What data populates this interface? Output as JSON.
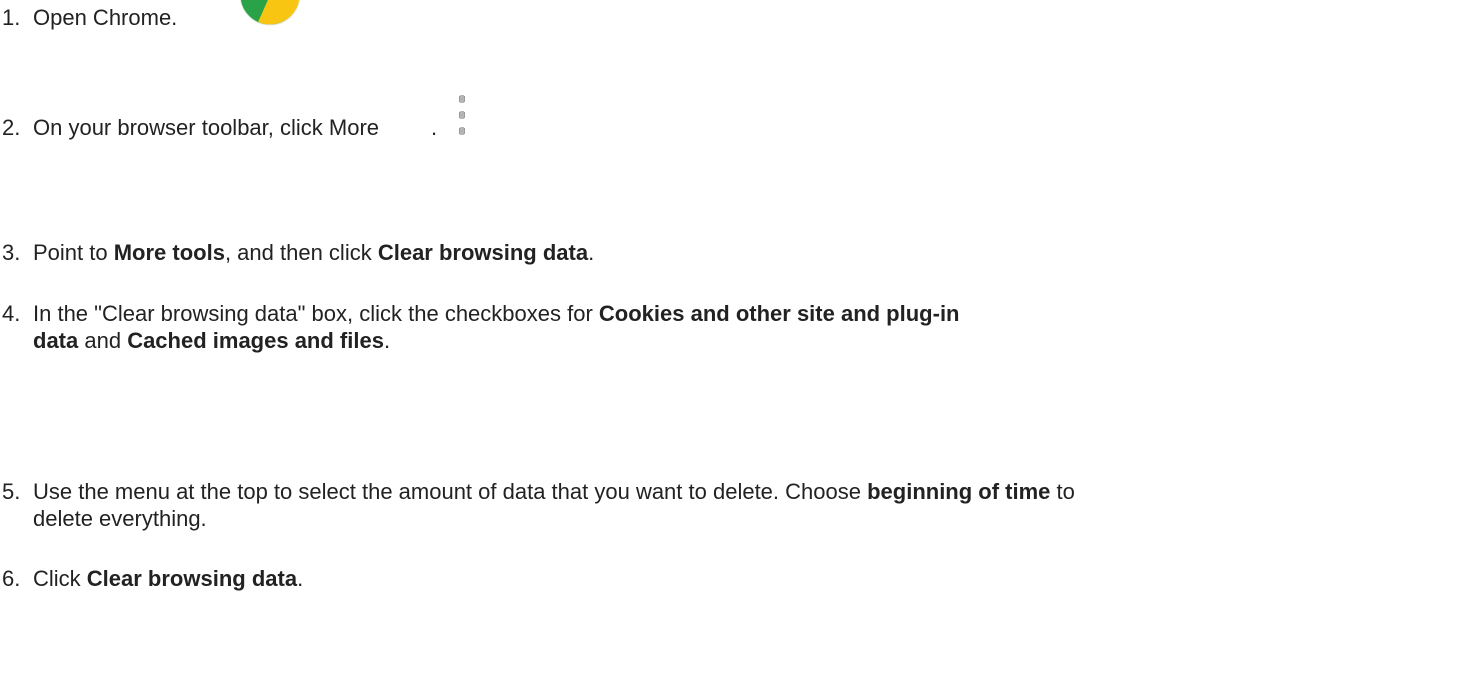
{
  "steps": [
    {
      "number": "1.",
      "parts": [
        {
          "text": "Open Chrome.",
          "bold": false
        }
      ],
      "icon": "chrome-logo-icon"
    },
    {
      "number": "2.",
      "parts": [
        {
          "text": "On your browser toolbar, click More",
          "bold": false
        },
        {
          "text": ".",
          "bold": false
        }
      ],
      "icon": "more-vertical-icon"
    },
    {
      "number": "3.",
      "parts": [
        {
          "text": "Point to ",
          "bold": false
        },
        {
          "text": "More tools",
          "bold": true
        },
        {
          "text": ", and then click ",
          "bold": false
        },
        {
          "text": "Clear browsing data",
          "bold": true
        },
        {
          "text": ".",
          "bold": false
        }
      ]
    },
    {
      "number": "4.",
      "parts": [
        {
          "text": "In the \"Clear browsing data\" box, click the checkboxes for ",
          "bold": false
        },
        {
          "text": "Cookies and other site and plug-in",
          "bold": true
        },
        {
          "text": "data",
          "bold": true
        },
        {
          "text": " and ",
          "bold": false
        },
        {
          "text": "Cached images and files",
          "bold": true
        },
        {
          "text": ".",
          "bold": false
        }
      ]
    },
    {
      "number": "5.",
      "parts": [
        {
          "text": "Use the menu at the top to select the amount of data that you want to delete. Choose ",
          "bold": false
        },
        {
          "text": "beginning of time",
          "bold": true
        },
        {
          "text": " to",
          "bold": false
        },
        {
          "text": "delete everything.",
          "bold": false
        }
      ]
    },
    {
      "number": "6.",
      "parts": [
        {
          "text": "Click ",
          "bold": false
        },
        {
          "text": "Clear browsing data",
          "bold": true
        },
        {
          "text": ".",
          "bold": false
        }
      ]
    }
  ]
}
